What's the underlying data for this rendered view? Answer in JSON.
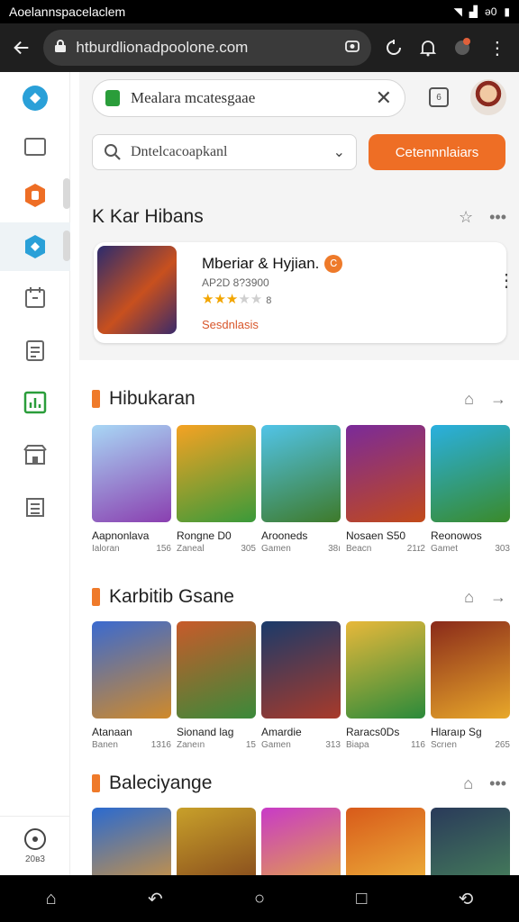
{
  "status": {
    "app_title": "Aoelannspacelaclem",
    "battery": "ǝ0"
  },
  "browser": {
    "url": "htburdlionadpoolone.com"
  },
  "header": {
    "search_text": "Mealara mcatesgaae",
    "dropdown_text": "Dntelcacoapkanl",
    "cta_label": "Cetennnlaiars"
  },
  "sidebar": {
    "bottom_label": "20ʙ3"
  },
  "featured": {
    "section_title": "K Kar Hibans",
    "name": "Mberiar & Hyjian.",
    "badge": "Ꮯ",
    "sub": "AP2D 8?3900",
    "rating_count": "8",
    "category": "Sesdnlasis"
  },
  "sections": [
    {
      "title": "Hibukaran",
      "games": [
        {
          "title": "Aapnonlava",
          "meta": "Ialoran",
          "num": "156",
          "colors": [
            "#a8d7f5",
            "#8a3fb0"
          ]
        },
        {
          "title": "Rongne D0",
          "meta": "Zaneal",
          "num": "305",
          "colors": [
            "#f5a223",
            "#3a9a3a"
          ]
        },
        {
          "title": "Arooneds",
          "meta": "Gamen",
          "num": "38ı",
          "colors": [
            "#51c4e8",
            "#3e7a2a"
          ]
        },
        {
          "title": "Nosaen S50",
          "meta": "Beacn",
          "num": "21ɪ2",
          "colors": [
            "#7a2a9a",
            "#c24a1a"
          ]
        },
        {
          "title": "Reonowos",
          "meta": "Gamet",
          "num": "303",
          "colors": [
            "#2ab0e0",
            "#3a8a2a"
          ]
        }
      ]
    },
    {
      "title": "Karbitib Gsane",
      "games": [
        {
          "title": "Atanaan",
          "meta": "Banen",
          "num": "1316",
          "colors": [
            "#3a6ad0",
            "#d08a2a"
          ]
        },
        {
          "title": "Sionand lag",
          "meta": "Zaneın",
          "num": "15",
          "colors": [
            "#c85a2a",
            "#3a8a3a"
          ]
        },
        {
          "title": "Amardie",
          "meta": "Gamen",
          "num": "313",
          "colors": [
            "#1a3a6a",
            "#a83a2a"
          ]
        },
        {
          "title": "Raracs0Ds",
          "meta": "Biapa",
          "num": "116",
          "colors": [
            "#e8b83a",
            "#2a8a3a"
          ]
        },
        {
          "title": "Hlaraıp Sg",
          "meta": "Scrıen",
          "num": "265",
          "colors": [
            "#8a2a1a",
            "#e8a82a"
          ]
        }
      ]
    },
    {
      "title": "Baleciyange",
      "games": [
        {
          "title": "",
          "meta": "",
          "num": "",
          "colors": [
            "#2a6ad0",
            "#e89a2a"
          ]
        },
        {
          "title": "",
          "meta": "",
          "num": "",
          "colors": [
            "#c8a02a",
            "#7a3a1a"
          ]
        },
        {
          "title": "",
          "meta": "",
          "num": "",
          "colors": [
            "#c83ac8",
            "#e8b82a"
          ]
        },
        {
          "title": "",
          "meta": "",
          "num": "",
          "colors": [
            "#d85a1a",
            "#f0c040"
          ]
        },
        {
          "title": "",
          "meta": "",
          "num": "",
          "colors": [
            "#2a3a5a",
            "#4a8a5a"
          ]
        }
      ]
    }
  ],
  "colors": {
    "accent": "#ee6e25",
    "sidebar_icon": "#2aa0d8"
  }
}
